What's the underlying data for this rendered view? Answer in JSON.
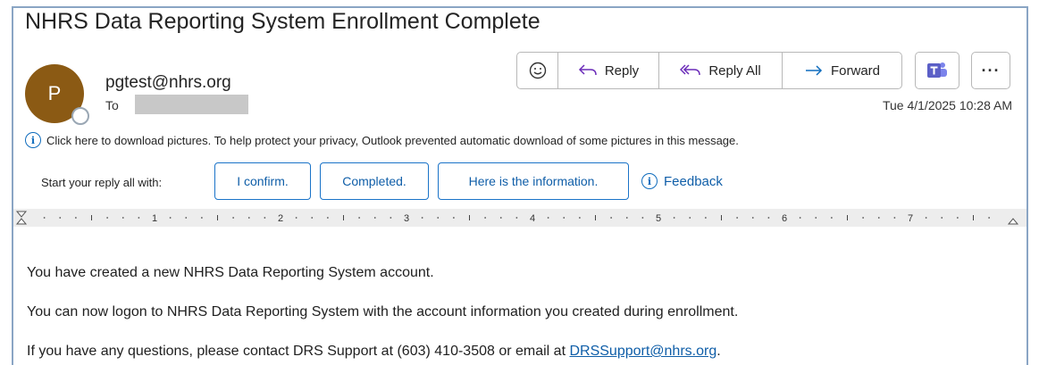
{
  "email": {
    "subject": "NHRS Data Reporting System Enrollment Complete",
    "avatar_initial": "P",
    "sender": "pgtest@nhrs.org",
    "to_label": "To",
    "timestamp": "Tue 4/1/2025 10:28 AM"
  },
  "actions": {
    "emoji_icon": "smiley-icon",
    "reply": "Reply",
    "reply_all": "Reply All",
    "forward": "Forward",
    "more": "···"
  },
  "infobar": {
    "message": "Click here to download pictures. To help protect your privacy, Outlook prevented automatic download of some pictures in this message."
  },
  "suggested_replies": {
    "label": "Start your reply all with:",
    "chips": [
      "I confirm.",
      "Completed.",
      "Here is the information."
    ],
    "feedback": "Feedback"
  },
  "ruler": {
    "numbers": [
      "1",
      "2",
      "3",
      "4",
      "5",
      "6",
      "7"
    ]
  },
  "body": {
    "line1": "You have created a new NHRS Data Reporting System account.",
    "line2": "You can now logon to NHRS Data Reporting System with the account information you created during enrollment.",
    "line3_prefix": "If you have any questions, please contact DRS Support at (603) 410-3508 or email at ",
    "line3_link": "DRSSupport@nhrs.org",
    "line3_suffix": "."
  },
  "colors": {
    "avatar": "#8b5a14",
    "accent_blue": "#0f6cbd",
    "teams_purple": "#5b5fc7",
    "frame_border": "#8aa5c4"
  }
}
